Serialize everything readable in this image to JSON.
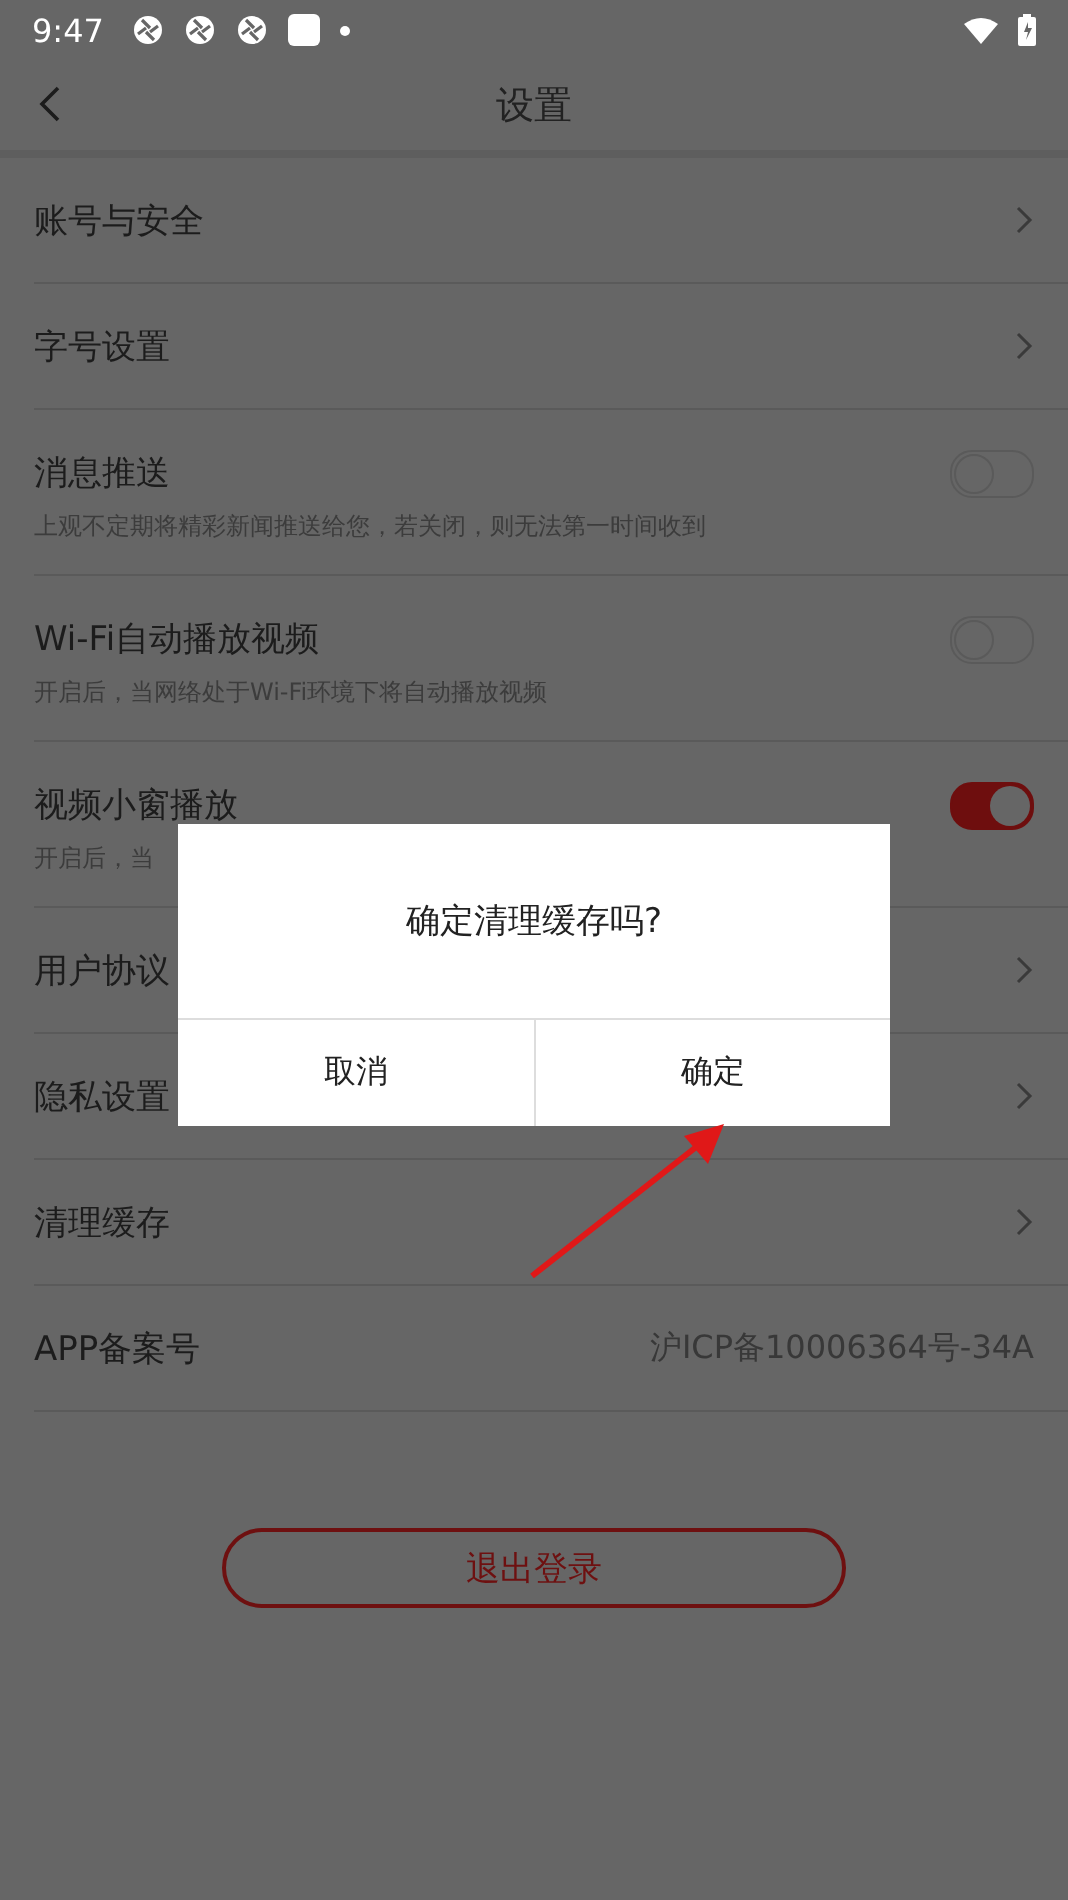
{
  "status_bar": {
    "time": "9:47"
  },
  "header": {
    "title": "设置"
  },
  "rows": [
    {
      "kind": "link",
      "label": "账号与安全"
    },
    {
      "kind": "link",
      "label": "字号设置"
    },
    {
      "kind": "toggle",
      "label": "消息推送",
      "on": false,
      "description": "上观不定期将精彩新闻推送给您，若关闭，则无法第一时间收到"
    },
    {
      "kind": "toggle",
      "label": "Wi-Fi自动播放视频",
      "on": false,
      "description": "开启后，当网络处于Wi-Fi环境下将自动播放视频"
    },
    {
      "kind": "toggle",
      "label": "视频小窗播放",
      "on": true,
      "description": "开启后，当"
    },
    {
      "kind": "link",
      "label": "用户协议"
    },
    {
      "kind": "link",
      "label": "隐私设置"
    },
    {
      "kind": "link",
      "label": "清理缓存"
    },
    {
      "kind": "info",
      "label": "APP备案号",
      "value": "沪ICP备10006364号-34A"
    }
  ],
  "logout_button": "退出登录",
  "dialog": {
    "message": "确定清理缓存吗?",
    "buttons": [
      "取消",
      "确定"
    ]
  }
}
